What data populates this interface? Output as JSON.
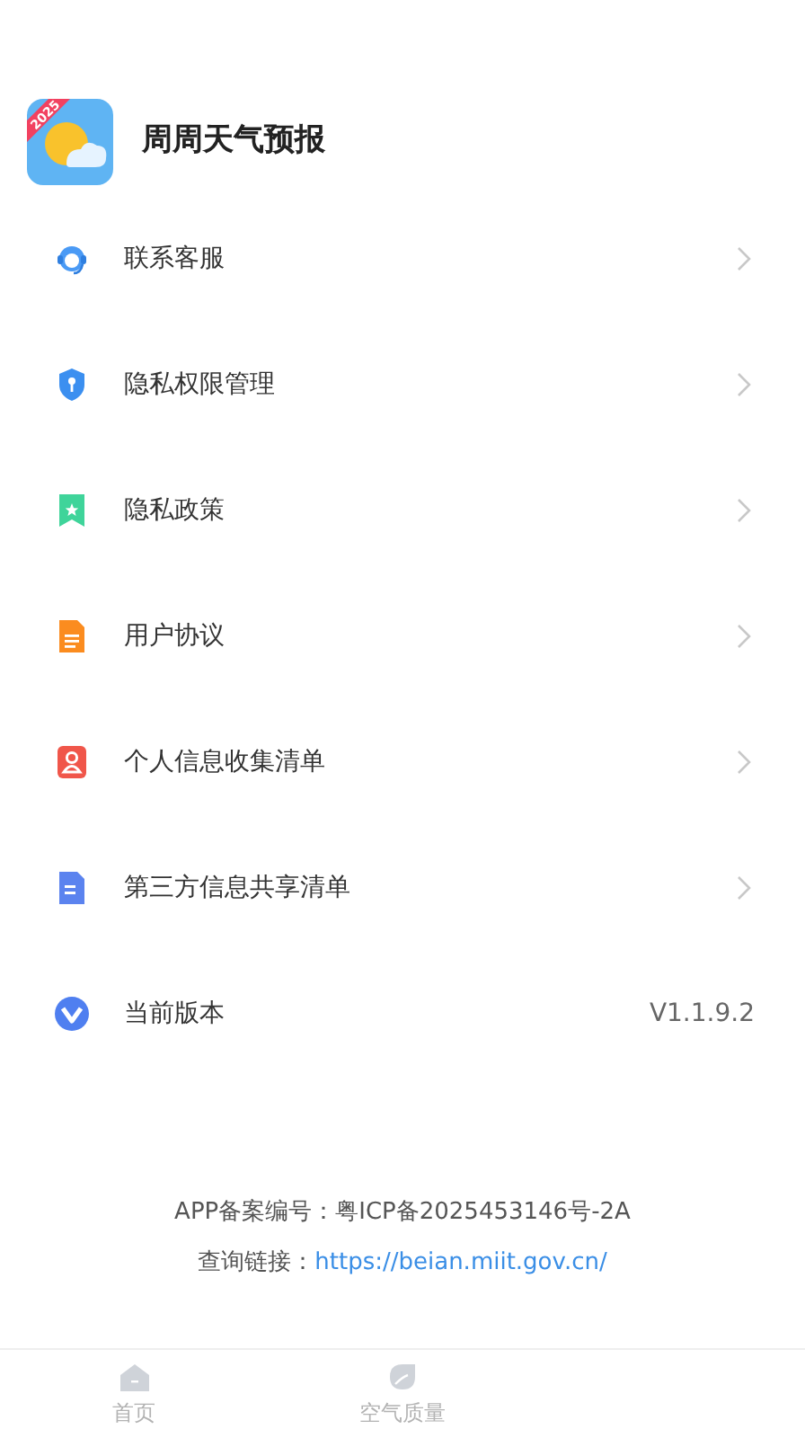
{
  "app": {
    "name": "周周天气预报",
    "badge": "2025"
  },
  "menu": [
    {
      "kind": "link",
      "label": "联系客服"
    },
    {
      "kind": "link",
      "label": "隐私权限管理"
    },
    {
      "kind": "link",
      "label": "隐私政策"
    },
    {
      "kind": "link",
      "label": "用户协议"
    },
    {
      "kind": "link",
      "label": "个人信息收集清单"
    },
    {
      "kind": "link",
      "label": "第三方信息共享清单"
    },
    {
      "kind": "version",
      "label": "当前版本",
      "value": "V1.1.9.2"
    }
  ],
  "footer": {
    "record": "APP备案编号：粤ICP备2025453146号-2A",
    "query_label": "查询链接：",
    "query_link": "https://beian.miit.gov.cn/"
  },
  "tabs": [
    {
      "label": "首页",
      "selected": false
    },
    {
      "label": "空气质量",
      "selected": false
    }
  ]
}
